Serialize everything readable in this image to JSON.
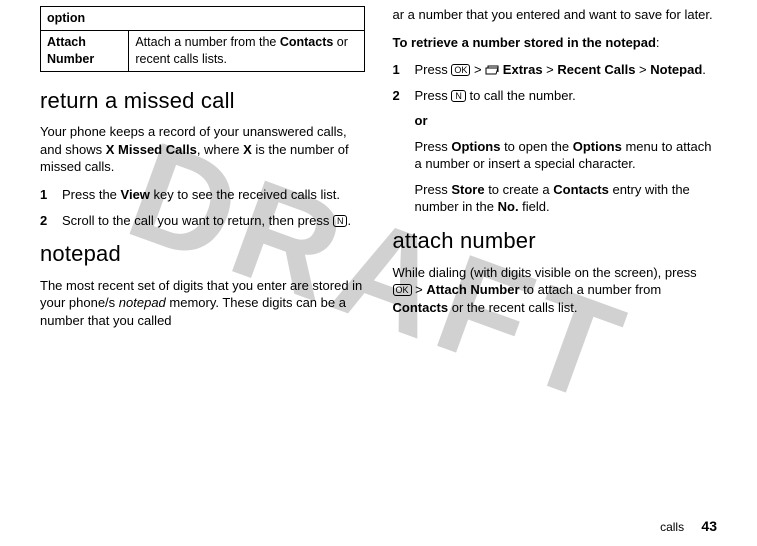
{
  "watermark": "DRAFT",
  "left": {
    "table": {
      "header": "option",
      "row_label": "Attach Number",
      "row_desc_pre": "Attach a number from the ",
      "row_desc_bold": "Contacts",
      "row_desc_post": " or recent calls lists."
    },
    "h_return": "return a missed call",
    "return_p1_a": "Your phone keeps a record of your unanswered calls, and shows ",
    "return_p1_b": "X Missed Calls",
    "return_p1_c": ", where ",
    "return_p1_d": "X",
    "return_p1_e": " is the number of missed calls.",
    "step1_num": "1",
    "step1_a": "Press the ",
    "step1_b": "View",
    "step1_c": " key to see the received calls list.",
    "step2_num": "2",
    "step2_a": "Scroll to the call you want to return, then press ",
    "step2_key": "N",
    "step2_b": ".",
    "h_notepad": "notepad",
    "notepad_p1_a": "The most recent set of digits that you enter are stored in your phone/s ",
    "notepad_p1_term": "notepad",
    "notepad_p1_b": " memory. These digits can be a number that you called "
  },
  "right": {
    "cont_p": "ar a number that you entered and want to save for later.",
    "retrieve_lead": "To retrieve a number stored in the notepad",
    "retrieve_colon": ":",
    "r_step1_num": "1",
    "r_step1_a": "Press ",
    "r_step1_key": "OK",
    "r_step1_gt1": " > ",
    "r_step1_extras": " Extras",
    "r_step1_gt2": " > ",
    "r_step1_recent": "Recent Calls",
    "r_step1_gt3": " > ",
    "r_step1_notepad": "Notepad",
    "r_step1_dot": ".",
    "r_step2_num": "2",
    "r_step2_a": "Press ",
    "r_step2_key": "N",
    "r_step2_b": " to call the number.",
    "or": "or",
    "r_step2_opt_a": "Press ",
    "r_step2_opt_b": "Options",
    "r_step2_opt_c": " to open the ",
    "r_step2_opt_d": "Options",
    "r_step2_opt_e": " menu to attach a number or insert a special character.",
    "r_store_a": "Press ",
    "r_store_b": "Store",
    "r_store_c": " to create a ",
    "r_store_d": "Contacts",
    "r_store_e": " entry with the number in the ",
    "r_store_f": "No.",
    "r_store_g": " field.",
    "h_attach": "attach number",
    "attach_p_a": "While dialing (with digits visible on the screen), press ",
    "attach_key": "OK",
    "attach_gt": " > ",
    "attach_b": "Attach Number",
    "attach_c": " to attach a number from ",
    "attach_d": "Contacts",
    "attach_e": " or the recent calls list."
  },
  "footer": {
    "section": "calls",
    "page": "43"
  }
}
